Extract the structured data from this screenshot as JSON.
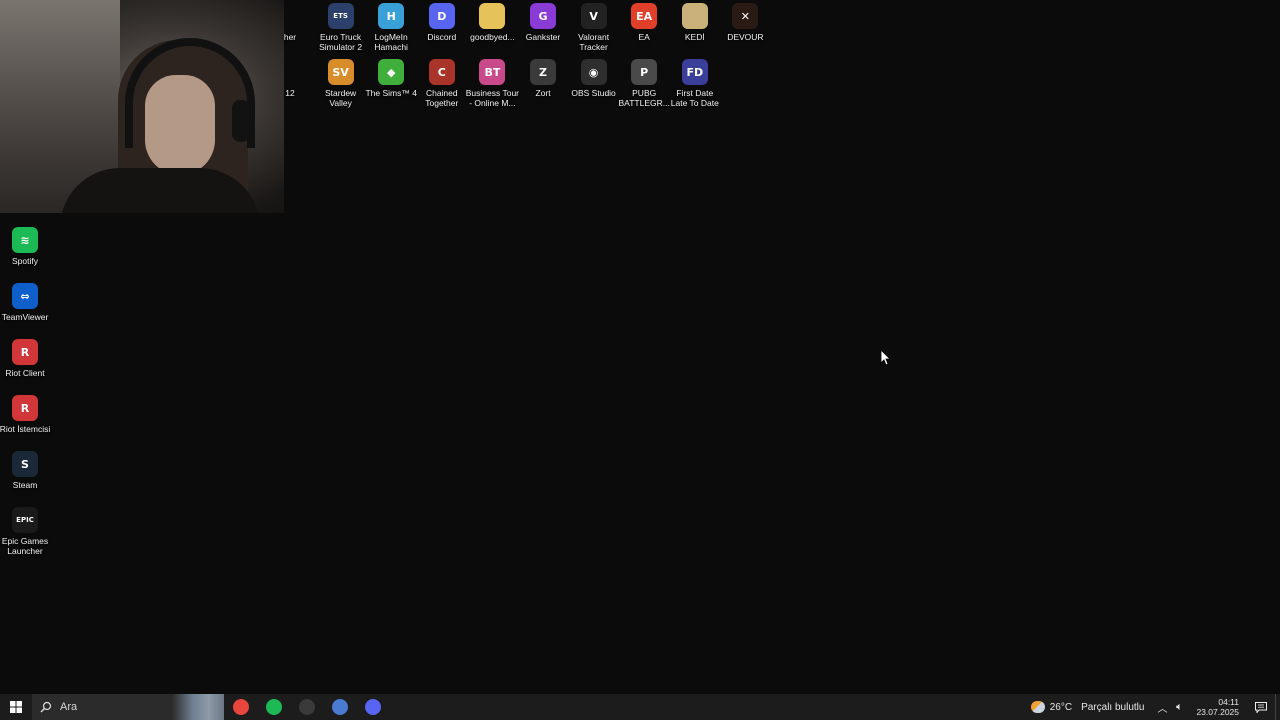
{
  "desktop": {
    "top_row": [
      {
        "label": "her",
        "name": "desktop-icon-partial-launcher",
        "color": "#444444",
        "glyph": ""
      },
      {
        "label": "Euro Truck Simulator 2",
        "name": "desktop-icon-euro-truck-simulator-2",
        "color": "#2d3f6b",
        "glyph": "ETS"
      },
      {
        "label": "LogMeIn Hamachi",
        "name": "desktop-icon-logmein-hamachi",
        "color": "#3aa0d8",
        "glyph": "H"
      },
      {
        "label": "Discord",
        "name": "desktop-icon-discord",
        "color": "#5865f2",
        "glyph": "D"
      },
      {
        "label": "goodbyed...",
        "name": "desktop-icon-goodbyed-folder",
        "color": "#e6c25a",
        "glyph": ""
      },
      {
        "label": "Gankster",
        "name": "desktop-icon-gankster",
        "color": "#8a3bd6",
        "glyph": "G"
      },
      {
        "label": "Valorant Tracker",
        "name": "desktop-icon-valorant-tracker",
        "color": "#222222",
        "glyph": "V"
      },
      {
        "label": "EA",
        "name": "desktop-icon-ea",
        "color": "#e0402a",
        "glyph": "EA"
      },
      {
        "label": "KEDİ",
        "name": "desktop-icon-kedi",
        "color": "#c9b27a",
        "glyph": ""
      },
      {
        "label": "DEVOUR",
        "name": "desktop-icon-devour",
        "color": "#2a1a14",
        "glyph": "✕"
      }
    ],
    "second_row": [
      {
        "label": "12",
        "name": "desktop-icon-partial-12",
        "color": "#444444",
        "glyph": ""
      },
      {
        "label": "Stardew Valley",
        "name": "desktop-icon-stardew-valley",
        "color": "#d88c2a",
        "glyph": "SV"
      },
      {
        "label": "The Sims™ 4",
        "name": "desktop-icon-the-sims-4",
        "color": "#3fae3a",
        "glyph": "◆"
      },
      {
        "label": "Chained Together",
        "name": "desktop-icon-chained-together",
        "color": "#a8342a",
        "glyph": "C"
      },
      {
        "label": "Business Tour - Online M...",
        "name": "desktop-icon-business-tour",
        "color": "#c94a8a",
        "glyph": "BT"
      },
      {
        "label": "Zort",
        "name": "desktop-icon-zort",
        "color": "#3a3a3a",
        "glyph": "Z"
      },
      {
        "label": "OBS Studio",
        "name": "desktop-icon-obs-studio",
        "color": "#2e2e2e",
        "glyph": "◉"
      },
      {
        "label": "PUBG BATTLEGR...",
        "name": "desktop-icon-pubg",
        "color": "#4a4a4a",
        "glyph": "P"
      },
      {
        "label": "First Date Late To Date",
        "name": "desktop-icon-first-date",
        "color": "#3a3f9a",
        "glyph": "FD"
      }
    ],
    "left_column": [
      {
        "label": "Spotify",
        "name": "desktop-icon-spotify",
        "color": "#1db954",
        "glyph": "≋"
      },
      {
        "label": "TeamViewer",
        "name": "desktop-icon-teamviewer",
        "color": "#0e5fc9",
        "glyph": "⇔"
      },
      {
        "label": "Riot Client",
        "name": "desktop-icon-riot-client",
        "color": "#d13639",
        "glyph": "R"
      },
      {
        "label": "Riot İstemcisi",
        "name": "desktop-icon-riot-istemcisi",
        "color": "#d13639",
        "glyph": "R"
      },
      {
        "label": "Steam",
        "name": "desktop-icon-steam",
        "color": "#1b2838",
        "glyph": "S"
      },
      {
        "label": "Epic Games Launcher",
        "name": "desktop-icon-epic-games-launcher",
        "color": "#1a1a1a",
        "glyph": "EPIC"
      }
    ]
  },
  "taskbar": {
    "search_placeholder": "Ara",
    "pinned": [
      {
        "name": "taskbar-chrome-icon",
        "color": "#e8453c"
      },
      {
        "name": "taskbar-spotify-icon",
        "color": "#1db954"
      },
      {
        "name": "taskbar-obs-icon",
        "color": "#3a3a3a"
      },
      {
        "name": "taskbar-app-icon",
        "color": "#4a7bd0"
      },
      {
        "name": "taskbar-discord-icon",
        "color": "#5865f2"
      }
    ],
    "weather_temp": "26°C",
    "weather_desc": "Parçalı bulutlu",
    "time": "04:11",
    "date": "23.07.2025"
  }
}
